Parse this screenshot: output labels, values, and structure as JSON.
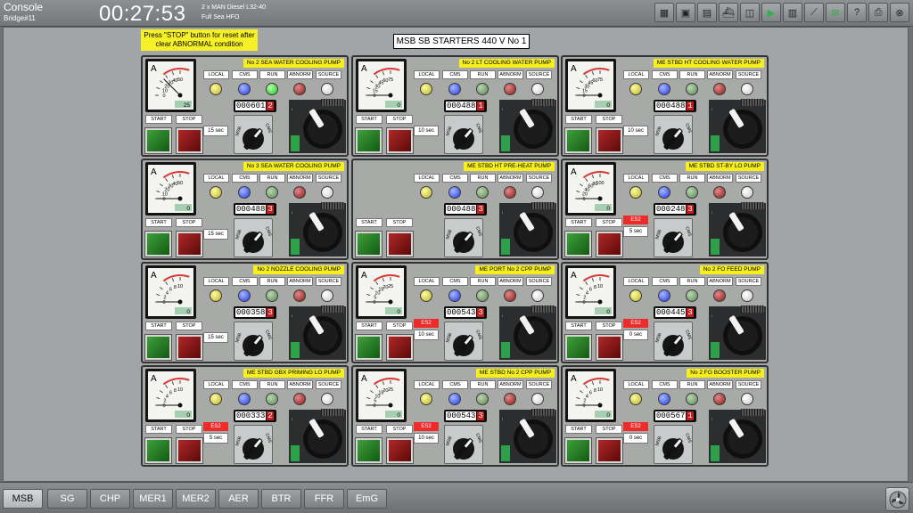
{
  "header": {
    "title": "Console",
    "subtitle": "Bridge#11",
    "clock": "00:27:53",
    "engine_line1": "2 x MAN Diesel L32-40",
    "engine_line2": "Full Sea HFO",
    "toolbar_icons": [
      "map-icon",
      "info-icon",
      "screen-icon",
      "ship-icon",
      "recorder-icon",
      "power-icon",
      "gauge-icon",
      "trend-icon",
      "chat-icon",
      "help-icon",
      "print-icon",
      "exit-icon"
    ]
  },
  "main": {
    "notice": "Press \"STOP\" button for reset after clear ABNORMAL condition",
    "title": "MSB SB STARTERS  440 V No 1"
  },
  "labels": {
    "local": "LOCAL",
    "cms": "CMS",
    "run": "RUN",
    "abnorm": "ABNORM",
    "source": "SOURCE",
    "start": "START",
    "stop": "STOP",
    "es2": "ES2",
    "msb": "MSB"
  },
  "panels": [
    {
      "title": "No 2 SEA WATER COOLING  PUMP",
      "meter_ticks": [
        "0",
        "10",
        "20",
        "30",
        "40",
        "50"
      ],
      "meter_reading": "25",
      "needle_fraction": 0.5,
      "run_on": true,
      "counter": "000601",
      "counter_last": "2",
      "es2": false,
      "delay": "15 sec"
    },
    {
      "title": "No 2 LT COOLING WATER PUMP",
      "meter_ticks": [
        "0",
        "15",
        "30",
        "45",
        "60",
        "75"
      ],
      "meter_reading": "0",
      "needle_fraction": 0,
      "run_on": false,
      "counter": "000488",
      "counter_last": "1",
      "es2": false,
      "delay": "10 sec"
    },
    {
      "title": "ME STBD HT COOLING WATER PUMP",
      "meter_ticks": [
        "0",
        "15",
        "30",
        "45",
        "60",
        "75"
      ],
      "meter_reading": "0",
      "needle_fraction": 0,
      "run_on": false,
      "counter": "000488",
      "counter_last": "1",
      "es2": false,
      "delay": "10 sec"
    },
    {
      "title": "No 3 SEA WATER COOLING  PUMP",
      "meter_ticks": [
        "0",
        "10",
        "20",
        "30",
        "40",
        "50"
      ],
      "meter_reading": "0",
      "needle_fraction": 0,
      "run_on": false,
      "counter": "000488",
      "counter_last": "3",
      "es2": false,
      "delay": "15 sec"
    },
    {
      "title": "ME STBD HT PRE-HEAT  PUMP",
      "no_meter": true,
      "run_on": false,
      "counter": "000488",
      "counter_last": "3",
      "es2": false,
      "delay": ""
    },
    {
      "title": "ME STBD ST-BY LO PUMP",
      "meter_ticks": [
        "0",
        "20",
        "40",
        "60",
        "80",
        "100"
      ],
      "meter_reading": "0",
      "needle_fraction": 0,
      "run_on": false,
      "counter": "000248",
      "counter_last": "3",
      "es2": true,
      "delay": "5 sec"
    },
    {
      "title": "No 2 NOZZLE COOLING PUMP",
      "meter_ticks": [
        "0",
        "2",
        "4",
        "6",
        "8",
        "10"
      ],
      "meter_reading": "0",
      "needle_fraction": 0,
      "run_on": false,
      "counter": "000358",
      "counter_last": "3",
      "es2": false,
      "delay": "15 sec"
    },
    {
      "title": "ME PORT No 2 CPP PUMP",
      "meter_ticks": [
        "0",
        "5",
        "10",
        "15",
        "20",
        "25"
      ],
      "meter_reading": "0",
      "needle_fraction": 0,
      "run_on": false,
      "counter": "000543",
      "counter_last": "3",
      "es2": true,
      "delay": "10 sec"
    },
    {
      "title": "No 2 FO FEED PUMP",
      "meter_ticks": [
        "0",
        "2",
        "4",
        "6",
        "8",
        "10"
      ],
      "meter_reading": "0",
      "needle_fraction": 0,
      "run_on": false,
      "counter": "000445",
      "counter_last": "3",
      "es2": true,
      "delay": "0 sec"
    },
    {
      "title": "ME STBD GBX PRIMING LO PUMP",
      "meter_ticks": [
        "0",
        "2",
        "4",
        "6",
        "8",
        "10"
      ],
      "meter_reading": "0",
      "needle_fraction": 0,
      "run_on": false,
      "counter": "000333",
      "counter_last": "2",
      "es2": true,
      "delay": "5 sec"
    },
    {
      "title": "ME STBD No 2 CPP PUMP",
      "meter_ticks": [
        "0",
        "5",
        "10",
        "15",
        "20",
        "25"
      ],
      "meter_reading": "0",
      "needle_fraction": 0,
      "run_on": false,
      "counter": "000543",
      "counter_last": "3",
      "es2": true,
      "delay": "10 sec"
    },
    {
      "title": "No 2 FO BOOSTER PUMP",
      "meter_ticks": [
        "0",
        "2",
        "4",
        "6",
        "8",
        "10"
      ],
      "meter_reading": "0",
      "needle_fraction": 0,
      "run_on": false,
      "counter": "000567",
      "counter_last": "1",
      "es2": true,
      "delay": "0 sec"
    }
  ],
  "tabs": [
    {
      "label": "MSB",
      "active": true
    },
    {
      "label": "SG",
      "active": false
    },
    {
      "label": "CHP",
      "active": false
    },
    {
      "label": "MER1",
      "active": false
    },
    {
      "label": "MER2",
      "active": false
    },
    {
      "label": "AER",
      "active": false
    },
    {
      "label": "BTR",
      "active": false
    },
    {
      "label": "FFR",
      "active": false
    },
    {
      "label": "EmG",
      "active": false
    }
  ],
  "fan_icon": "fan-icon"
}
